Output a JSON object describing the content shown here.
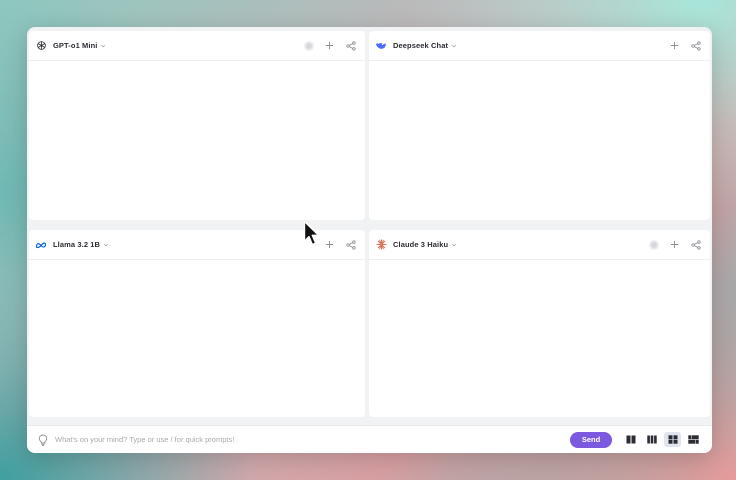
{
  "panes": [
    {
      "model": "GPT-o1 Mini",
      "logo_icon": "openai-logo-icon",
      "has_status": true
    },
    {
      "model": "Deepseek Chat",
      "logo_icon": "deepseek-logo-icon",
      "has_status": false
    },
    {
      "model": "Llama 3.2 1B",
      "logo_icon": "meta-logo-icon",
      "has_status": false
    },
    {
      "model": "Claude 3 Haiku",
      "logo_icon": "claude-logo-icon",
      "has_status": true
    }
  ],
  "input": {
    "placeholder": "What's on your mind? Type or use / for quick prompts!",
    "value": ""
  },
  "send_label": "Send",
  "layouts": [
    {
      "name": "two-column",
      "active": false
    },
    {
      "name": "three-column",
      "active": false
    },
    {
      "name": "grid-2x2",
      "active": true
    },
    {
      "name": "grid-wide",
      "active": false
    }
  ],
  "colors": {
    "accent": "#7b5ae0",
    "deepseek": "#4d6bfe",
    "meta": "#0668e1",
    "claude": "#d97757"
  }
}
